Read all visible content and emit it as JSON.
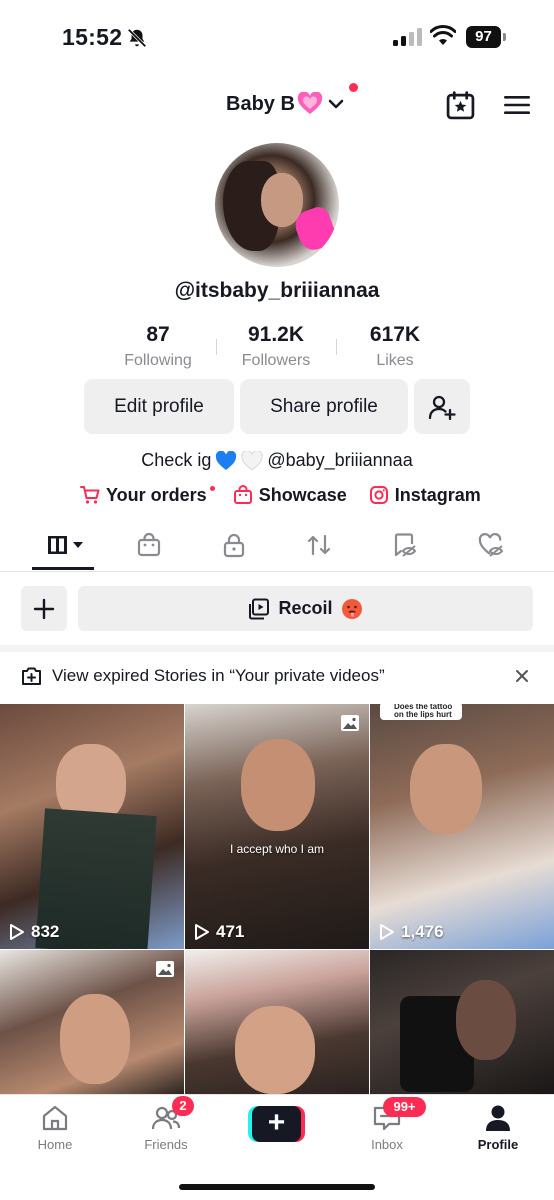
{
  "status_bar": {
    "time": "15:52",
    "battery": "97"
  },
  "header": {
    "account_name": "Baby B"
  },
  "profile": {
    "handle": "@itsbaby_briiiannaa",
    "stats": [
      {
        "value": "87",
        "label": "Following"
      },
      {
        "value": "91.2K",
        "label": "Followers"
      },
      {
        "value": "617K",
        "label": "Likes"
      }
    ],
    "edit_label": "Edit profile",
    "share_label": "Share profile",
    "bio_prefix": "Check ig",
    "bio_handle": "@baby_briiiannaa",
    "links": {
      "orders": "Your orders",
      "showcase": "Showcase",
      "instagram": "Instagram"
    }
  },
  "tabs": [
    {
      "icon": "grid-icon",
      "active": true
    },
    {
      "icon": "shopping-bag-icon",
      "active": false
    },
    {
      "icon": "lock-icon",
      "active": false
    },
    {
      "icon": "repost-icon",
      "active": false
    },
    {
      "icon": "hidden-favorites-icon",
      "active": false
    },
    {
      "icon": "hidden-liked-icon",
      "active": false
    }
  ],
  "actions": {
    "recoil_label": "Recoil"
  },
  "stories_banner": {
    "text": "View expired Stories in “Your private videos”"
  },
  "videos": [
    {
      "views": "832"
    },
    {
      "views": "471",
      "caption": "I accept who I am"
    },
    {
      "views": "1,476",
      "sticker": "Does the tattoo on the lips hurt"
    },
    {
      "views": ""
    },
    {
      "views": ""
    },
    {
      "views": ""
    }
  ],
  "nav": {
    "home": "Home",
    "friends": "Friends",
    "friends_badge": "2",
    "inbox": "Inbox",
    "inbox_badge": "99+",
    "profile": "Profile"
  },
  "colors": {
    "accent": "#fe2c55",
    "cyan": "#25f4ee",
    "text": "#161823",
    "muted": "#8a8b91"
  }
}
